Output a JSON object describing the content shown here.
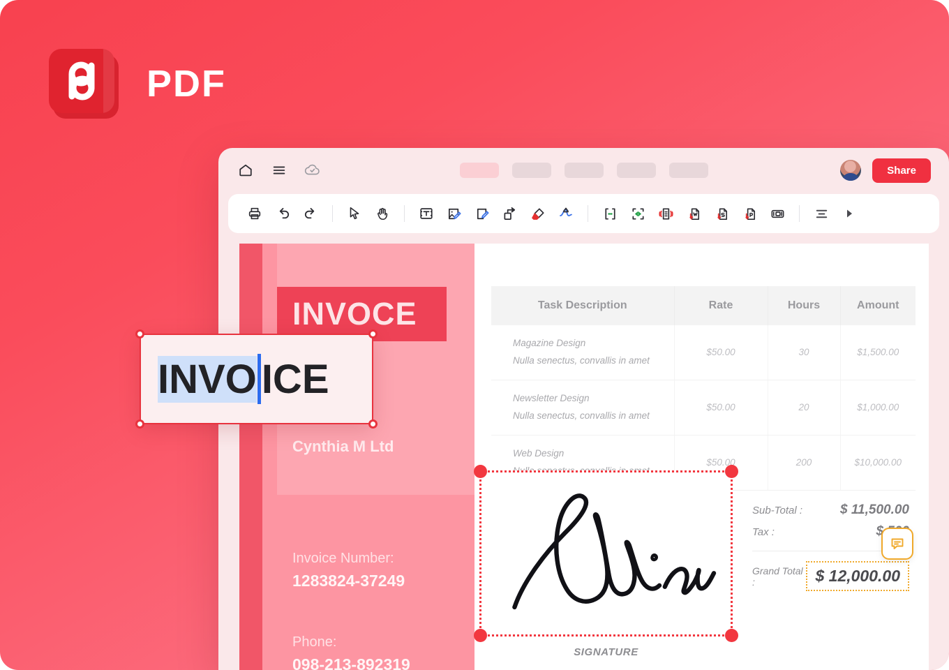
{
  "brand": {
    "title": "PDF",
    "logo_icon": "pdf-logo-icon",
    "logo_color": "#E0232F"
  },
  "background": {
    "gradient_from": "#F8414F",
    "gradient_to": "#FD7F90"
  },
  "app": {
    "header": {
      "icons": [
        {
          "name": "home-icon",
          "label": "Home"
        },
        {
          "name": "hamburger-menu-icon",
          "label": "Menu"
        },
        {
          "name": "cloud-check-icon",
          "label": "Saved to cloud"
        }
      ],
      "tabs": [
        {
          "name": "tab-1",
          "active": true
        },
        {
          "name": "tab-2",
          "active": false
        },
        {
          "name": "tab-3",
          "active": false
        },
        {
          "name": "tab-4",
          "active": false
        },
        {
          "name": "tab-5",
          "active": false
        }
      ],
      "avatar": "user-avatar",
      "share_label": "Share",
      "share_color": "#F03040"
    },
    "toolbar": {
      "items": [
        {
          "name": "print-icon",
          "label": "Print"
        },
        {
          "name": "undo-icon",
          "label": "Undo"
        },
        {
          "name": "redo-icon",
          "label": "Redo"
        },
        {
          "name": "select-cursor-icon",
          "label": "Select"
        },
        {
          "name": "hand-pan-icon",
          "label": "Pan"
        },
        {
          "name": "add-textbox-icon",
          "label": "Add text box"
        },
        {
          "name": "edit-image-icon",
          "label": "Edit image"
        },
        {
          "name": "edit-page-icon",
          "label": "Edit page"
        },
        {
          "name": "shape-arrow-icon",
          "label": "Shapes"
        },
        {
          "name": "eraser-icon",
          "label": "Eraser"
        },
        {
          "name": "signature-icon",
          "label": "Signature"
        },
        {
          "name": "split-pdf-icon",
          "label": "Split PDF"
        },
        {
          "name": "merge-pdf-icon",
          "label": "Merge PDF"
        },
        {
          "name": "compress-pdf-icon",
          "label": "Compress PDF"
        },
        {
          "name": "pdf-to-word-icon",
          "label": "PDF to Word"
        },
        {
          "name": "pdf-to-sheet-icon",
          "label": "PDF to Sheet"
        },
        {
          "name": "pdf-to-ppt-icon",
          "label": "PDF to PPT"
        },
        {
          "name": "organize-pages-icon",
          "label": "Organize pages"
        },
        {
          "name": "align-icon",
          "label": "Align"
        },
        {
          "name": "more-arrow-icon",
          "label": "More"
        }
      ]
    }
  },
  "document": {
    "banner_title": "INVOCE",
    "company": "Cynthia M Ltd",
    "fields": [
      {
        "label": "Invoice Number:",
        "value": "1283824-37249"
      },
      {
        "label": "Phone:",
        "value": "098-213-892319"
      }
    ],
    "table": {
      "headers": [
        "Task Description",
        "Rate",
        "Hours",
        "Amount"
      ],
      "rows": [
        {
          "title": "Magazine Design",
          "subtitle": "Nulla senectus, convallis in amet",
          "rate": "$50.00",
          "hours": "30",
          "amount": "$1,500.00"
        },
        {
          "title": "Newsletter Design",
          "subtitle": "Nulla senectus, convallis in amet",
          "rate": "$50.00",
          "hours": "20",
          "amount": "$1,000.00"
        },
        {
          "title": "Web Design",
          "subtitle": "Nulla senectus, convallis in amet",
          "rate": "$50.00",
          "hours": "200",
          "amount": "$10,000.00"
        }
      ]
    },
    "totals": {
      "subtotal_label": "Sub-Total :",
      "subtotal_value": "$ 11,500.00",
      "tax_label": "Tax :",
      "tax_value": "$ 500",
      "grand_label": "Grand Total :",
      "grand_value": "$ 12,000.00",
      "highlight_color": "#F0A92B",
      "comment_icon": "comment-bubble-icon"
    },
    "signature": {
      "name": "Jillian",
      "caption": "SIGNATURE",
      "selection_color": "#F2373F"
    }
  },
  "text_edit": {
    "selected_text": "INVO",
    "remaining_text": "ICE",
    "full_text": "INVOICE",
    "selection_color": "#CFE0FA",
    "caret_color": "#2B6CEF",
    "border_color": "#E8333E"
  }
}
